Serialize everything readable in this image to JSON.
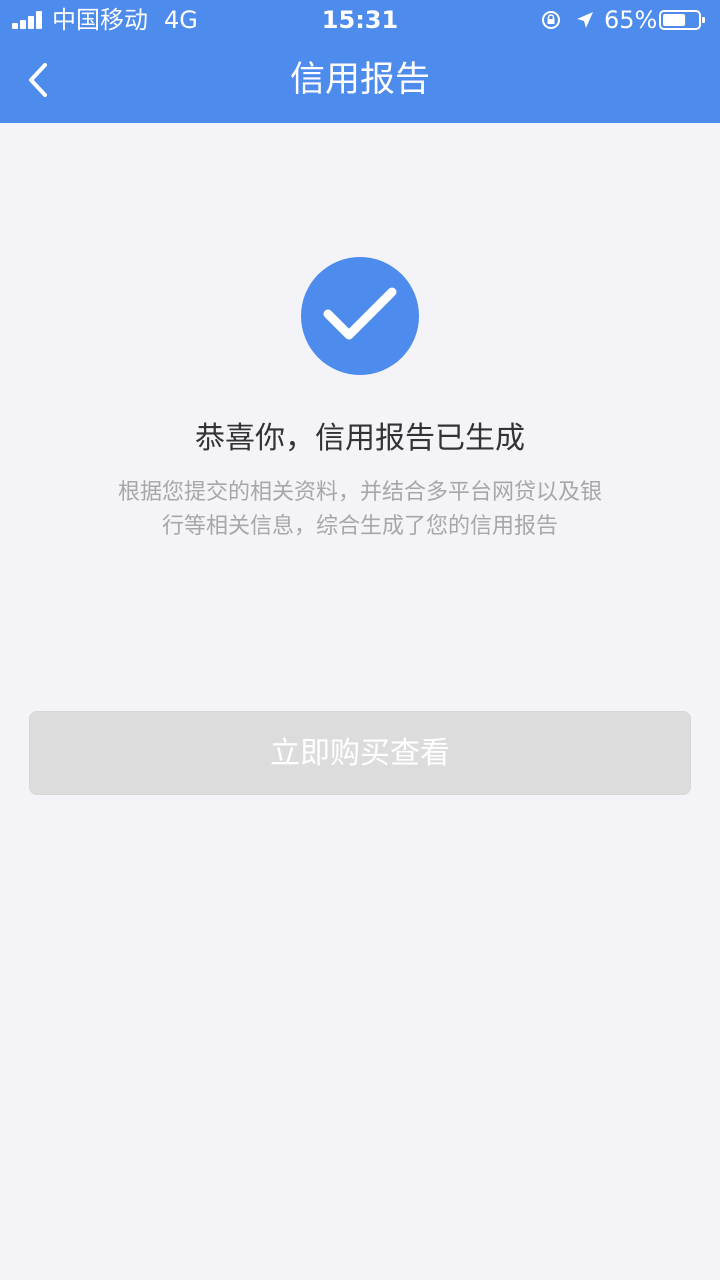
{
  "status_bar": {
    "carrier": "中国移动",
    "network": "4G",
    "time": "15:31",
    "battery_percent": "65%",
    "battery_level": 0.65,
    "icons": [
      "signal-icon",
      "lock-rotation-icon",
      "location-icon",
      "battery-icon"
    ]
  },
  "nav": {
    "title": "信用报告",
    "back_icon": "chevron-left-icon"
  },
  "content": {
    "success_icon": "check-circle-icon",
    "title": "恭喜你，信用报告已生成",
    "description": "根据您提交的相关资料，并结合多平台网贷以及银行等相关信息，综合生成了您的信用报告",
    "button_label": "立即购买查看"
  },
  "colors": {
    "header": "#4d8bec",
    "background": "#f4f3f7",
    "title_text": "#333333",
    "description_text": "#a7a7aa",
    "button_background": "#dcdcdc",
    "button_text": "#ffffff"
  }
}
